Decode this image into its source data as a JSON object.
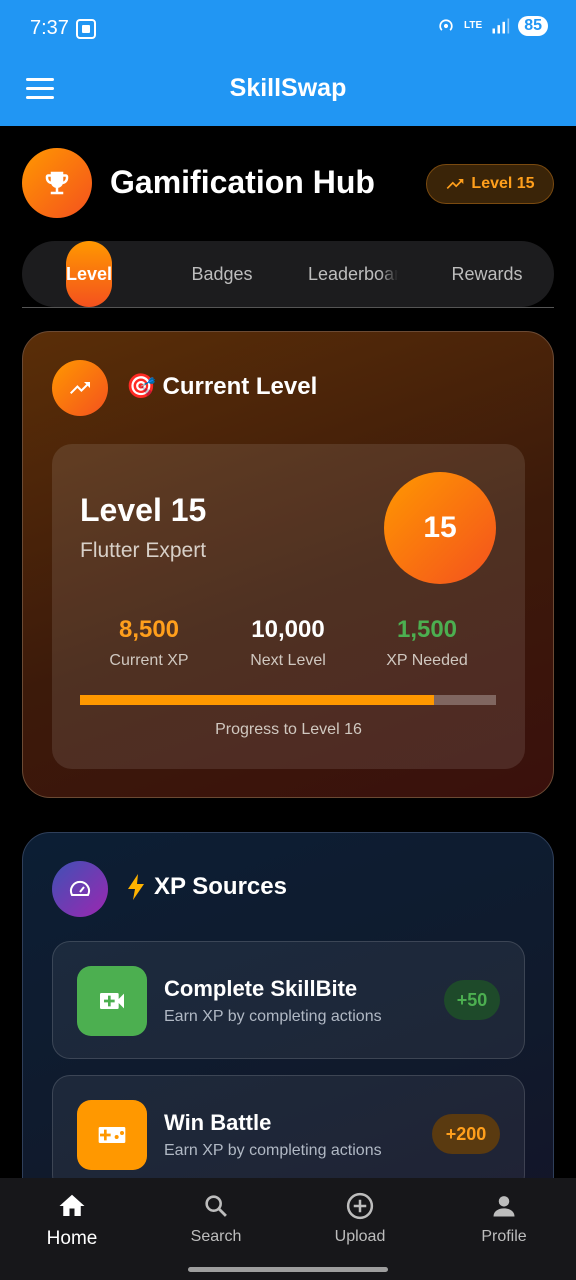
{
  "status_bar": {
    "time": "7:37",
    "network": "LTE",
    "battery": "85"
  },
  "app_bar": {
    "title": "SkillSwap"
  },
  "header": {
    "title": "Gamification Hub",
    "level_chip": "Level 15"
  },
  "tabs": [
    {
      "label": "Level",
      "active": true
    },
    {
      "label": "Badges",
      "active": false
    },
    {
      "label": "Leaderboard",
      "active": false
    },
    {
      "label": "Rewards",
      "active": false
    }
  ],
  "current_level": {
    "title": "🎯 Current Level",
    "level_name": "Level 15",
    "level_subtitle": "Flutter Expert",
    "level_number": "15",
    "stats": [
      {
        "value": "8,500",
        "label": "Current XP"
      },
      {
        "value": "10,000",
        "label": "Next Level"
      },
      {
        "value": "1,500",
        "label": "XP Needed"
      }
    ],
    "progress_fraction": 0.85,
    "progress_label": "Progress to Level 16"
  },
  "xp_sources": {
    "title": "XP Sources",
    "items": [
      {
        "title": "Complete SkillBite",
        "subtitle": "Earn XP by completing actions",
        "points": "+50",
        "icon": "video-call-icon"
      },
      {
        "title": "Win Battle",
        "subtitle": "Earn XP by completing actions",
        "points": "+200",
        "icon": "gamepad-icon"
      }
    ]
  },
  "bottom_nav": [
    {
      "label": "Home",
      "icon": "home-icon",
      "active": true
    },
    {
      "label": "Search",
      "icon": "search-icon",
      "active": false
    },
    {
      "label": "Upload",
      "icon": "add-circle-icon",
      "active": false
    },
    {
      "label": "Profile",
      "icon": "person-icon",
      "active": false
    }
  ],
  "colors": {
    "primary": "#2196F3",
    "accent_orange": "#FF9800",
    "success_green": "#4CAF50"
  }
}
